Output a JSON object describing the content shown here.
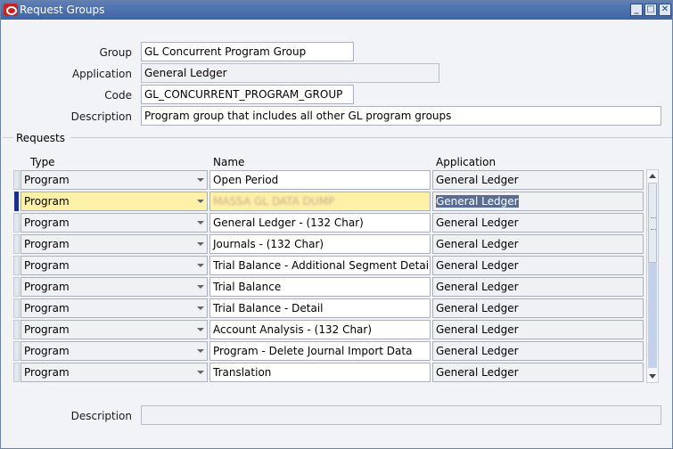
{
  "window": {
    "title": "Request Groups",
    "minimize_label": "_",
    "maximize_label": "□",
    "close_label": "✕"
  },
  "form": {
    "group_label": "Group",
    "group_value": "GL Concurrent Program Group",
    "application_label": "Application",
    "application_value": "General Ledger",
    "code_label": "Code",
    "code_value": "GL_CONCURRENT_PROGRAM_GROUP",
    "description_label": "Description",
    "description_value": "Program group that includes all other GL program groups"
  },
  "requests": {
    "section_label": "Requests",
    "columns": {
      "type": "Type",
      "name": "Name",
      "application": "Application"
    },
    "rows": [
      {
        "type": "Program",
        "name": "Open Period",
        "application": "General Ledger"
      },
      {
        "type": "Program",
        "name": "MASSA GL DATA DUMP",
        "application": "General Ledger"
      },
      {
        "type": "Program",
        "name": "General Ledger - (132 Char)",
        "application": "General Ledger"
      },
      {
        "type": "Program",
        "name": "Journals - (132 Char)",
        "application": "General Ledger"
      },
      {
        "type": "Program",
        "name": "Trial Balance - Additional Segment Detail",
        "application": "General Ledger"
      },
      {
        "type": "Program",
        "name": "Trial Balance",
        "application": "General Ledger"
      },
      {
        "type": "Program",
        "name": "Trial Balance - Detail",
        "application": "General Ledger"
      },
      {
        "type": "Program",
        "name": "Account Analysis - (132 Char)",
        "application": "General Ledger"
      },
      {
        "type": "Program",
        "name": "Program - Delete Journal Import Data",
        "application": "General Ledger"
      },
      {
        "type": "Program",
        "name": "Translation",
        "application": "General Ledger"
      }
    ]
  },
  "footer": {
    "description_label": "Description",
    "description_value": ""
  },
  "icons": {
    "app": "oracle-icon",
    "minimize": "minimize-icon",
    "maximize": "maximize-icon",
    "close": "close-icon"
  }
}
